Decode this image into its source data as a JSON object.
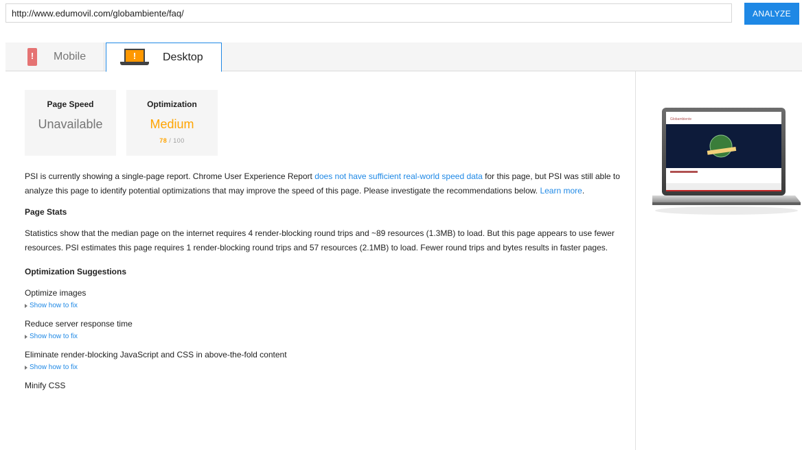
{
  "search": {
    "url_value": "http://www.edumovil.com/globambiente/faq/",
    "analyze_label": "ANALYZE"
  },
  "tabs": {
    "mobile_label": "Mobile",
    "desktop_label": "Desktop"
  },
  "scores": {
    "speed_title": "Page Speed",
    "speed_value": "Unavailable",
    "opt_title": "Optimization",
    "opt_value": "Medium",
    "opt_score": "78",
    "opt_max": "/ 100"
  },
  "report": {
    "intro_1": "PSI is currently showing a single-page report. Chrome User Experience Report ",
    "intro_link": "does not have sufficient real-world speed data",
    "intro_2": " for this page, but PSI was still able to analyze this page to identify potential optimizations that may improve the speed of this page. Please investigate the recommendations below. ",
    "learn_more": "Learn more",
    "intro_end": ".",
    "stats_heading": "Page Stats",
    "stats_text": "Statistics show that the median page on the internet requires 4 render-blocking round trips and ~89 resources (1.3MB) to load. But this page appears to use fewer resources. PSI estimates this page requires 1 render-blocking round trips and 57 resources (2.1MB) to load. Fewer round trips and bytes results in faster pages.",
    "suggestions_heading": "Optimization Suggestions",
    "fix_label": "Show how to fix",
    "suggestions": [
      "Optimize images",
      "Reduce server response time",
      "Eliminate render-blocking JavaScript and CSS in above-the-fold content",
      "Minify CSS"
    ]
  },
  "preview": {
    "site_name": "Globambiente"
  },
  "colors": {
    "accent": "#1e88e5",
    "medium": "#ffa400",
    "mobile_icon": "#e57373",
    "desktop_icon": "#ff9800"
  }
}
